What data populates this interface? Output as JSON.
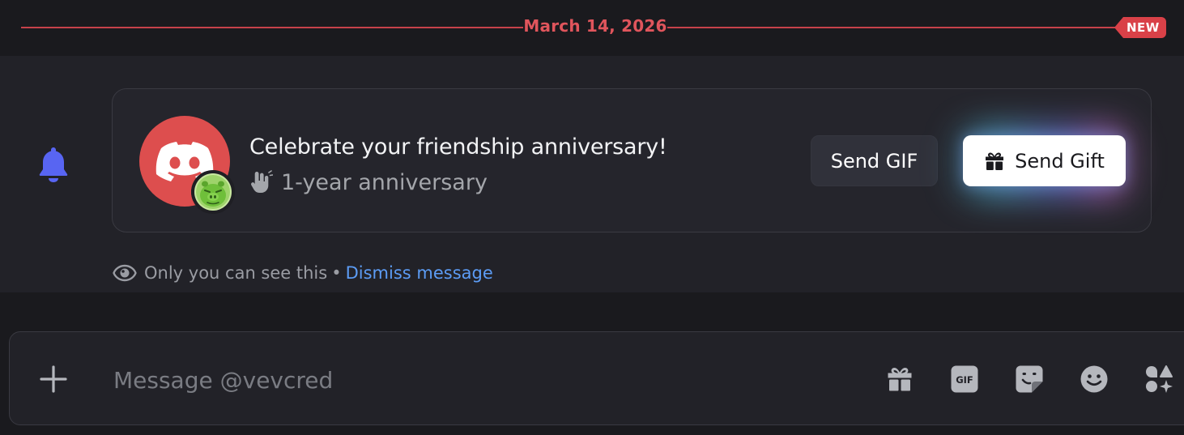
{
  "divider": {
    "date": "March 14, 2026",
    "badge": "NEW"
  },
  "card": {
    "title": "Celebrate your friendship anniversary!",
    "subtitle": "1-year anniversary",
    "send_gif_label": "Send GIF",
    "send_gift_label": "Send Gift"
  },
  "notice": {
    "text": "Only you can see this",
    "separator": "•",
    "dismiss_label": "Dismiss message"
  },
  "composer": {
    "placeholder": "Message @vevcred"
  },
  "icons": {
    "notification": "bell-icon",
    "sender_avatar": "discord-logo-icon",
    "friend_avatar": "pig-avatar-icon",
    "subtitle": "waving-hand-icon",
    "gift_button": "gift-icon",
    "notice": "eye-icon",
    "attach": "plus-icon",
    "composer_gift": "gift-icon",
    "composer_gif": "gif-icon",
    "composer_sticker": "sticker-icon",
    "composer_emoji": "emoji-icon",
    "composer_apps": "apps-icon"
  },
  "colors": {
    "accent_red": "#d94148",
    "bell_blurple": "#5865f2",
    "avatar_red": "#dd4e4e",
    "link_blue": "#5c9cf5"
  }
}
